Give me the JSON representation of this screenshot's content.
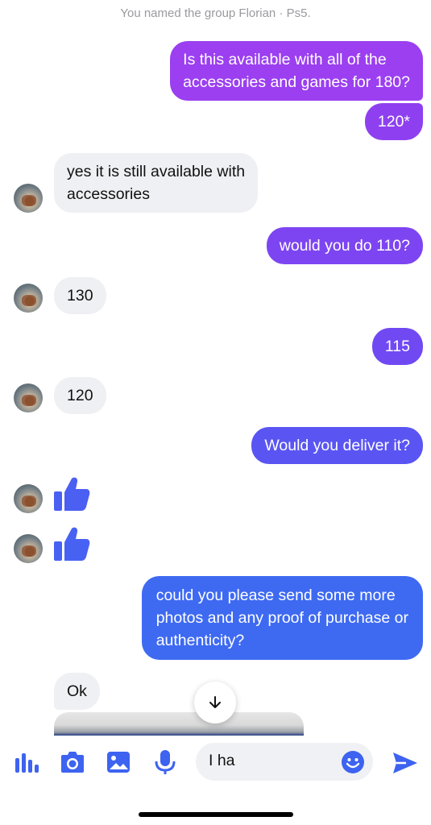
{
  "system_message": "You named the group Florian · Ps5.",
  "messages": [
    {
      "side": "out",
      "lines": [
        "Is this available with all of the",
        "accessories and games for 180?"
      ]
    },
    {
      "side": "out",
      "lines": [
        "120*"
      ]
    },
    {
      "side": "in",
      "lines": [
        "yes it is still available with",
        "accessories"
      ]
    },
    {
      "side": "out",
      "lines": [
        "would you do 110?"
      ]
    },
    {
      "side": "in",
      "lines": [
        "130"
      ]
    },
    {
      "side": "out",
      "lines": [
        "115"
      ]
    },
    {
      "side": "in",
      "lines": [
        "120"
      ]
    },
    {
      "side": "out",
      "lines": [
        "Would you deliver it?"
      ]
    },
    {
      "side": "in",
      "type": "like"
    },
    {
      "side": "in",
      "type": "like"
    },
    {
      "side": "out",
      "lines": [
        "could you please send some more",
        "photos and any proof of purchase or",
        "authenticity?"
      ]
    },
    {
      "side": "in",
      "lines": [
        "Ok"
      ]
    },
    {
      "side": "in",
      "type": "image"
    }
  ],
  "composer": {
    "text": "I ha"
  },
  "icons": {
    "scroll_down": "arrow-down-icon",
    "more_actions": "audio-bars-icon",
    "camera": "camera-icon",
    "gallery": "image-icon",
    "voice": "microphone-icon",
    "emoji": "smiley-icon",
    "send": "send-icon",
    "like": "thumbs-up-icon"
  },
  "colors": {
    "gradient_top": "#9b3ff0",
    "gradient_mid": "#6b4ff2",
    "gradient_bottom": "#3b6cf2",
    "incoming_bubble": "#eff0f3",
    "icon_blue": "#3d63f0",
    "system_text": "#9a9a9f"
  }
}
